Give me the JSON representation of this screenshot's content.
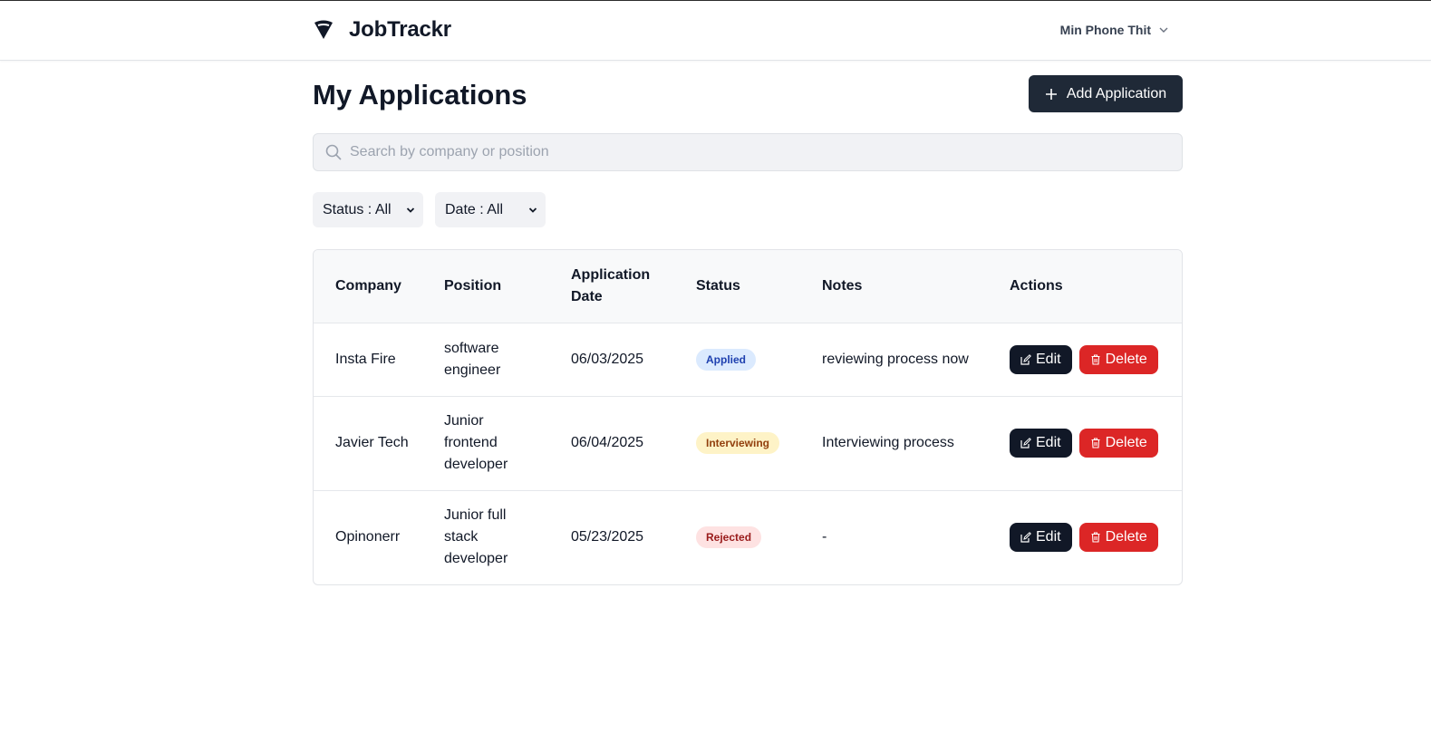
{
  "header": {
    "brand_name": "JobTrackr",
    "user_name": "Min Phone Thit"
  },
  "page": {
    "title": "My Applications",
    "add_button_label": "Add Application"
  },
  "search": {
    "placeholder": "Search by company or position",
    "value": ""
  },
  "filters": {
    "status_label": "Status : All",
    "date_label": "Date : All"
  },
  "table": {
    "columns": [
      "Company",
      "Position",
      "Application Date",
      "Status",
      "Notes",
      "Actions"
    ],
    "rows": [
      {
        "company": "Insta Fire",
        "position": "software engineer",
        "date": "06/03/2025",
        "status": "Applied",
        "notes": "reviewing process now"
      },
      {
        "company": "Javier Tech",
        "position": "Junior frontend developer",
        "date": "06/04/2025",
        "status": "Interviewing",
        "notes": "Interviewing process"
      },
      {
        "company": "Opinonerr",
        "position": "Junior full stack developer",
        "date": "05/23/2025",
        "status": "Rejected",
        "notes": "-"
      }
    ],
    "edit_label": "Edit",
    "delete_label": "Delete"
  },
  "colors": {
    "primary_dark": "#1f2937",
    "danger": "#dc2626",
    "applied": "#dbeafe",
    "interviewing": "#fef3c7",
    "rejected": "#fee2e2"
  },
  "icons": [
    "brand-logo-icon",
    "chevron-down-icon",
    "plus-icon",
    "search-icon",
    "edit-icon",
    "trash-icon"
  ]
}
